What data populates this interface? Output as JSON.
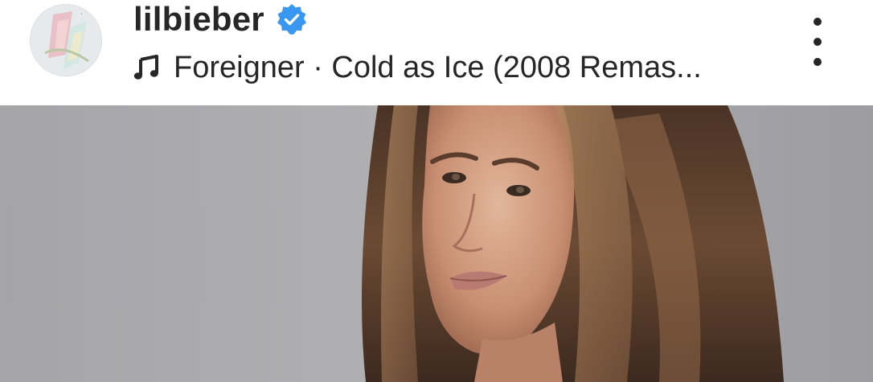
{
  "post": {
    "username": "lilbieber",
    "verified": true,
    "audio": {
      "icon": "music-note-icon",
      "text": "Foreigner · Cold as Ice (2008 Remas..."
    },
    "more_icon": "more-vertical-icon"
  },
  "colors": {
    "text": "#262626",
    "verified_badge": "#3897f0",
    "background": "#ffffff",
    "photo_backdrop": "#a9a9ab"
  }
}
